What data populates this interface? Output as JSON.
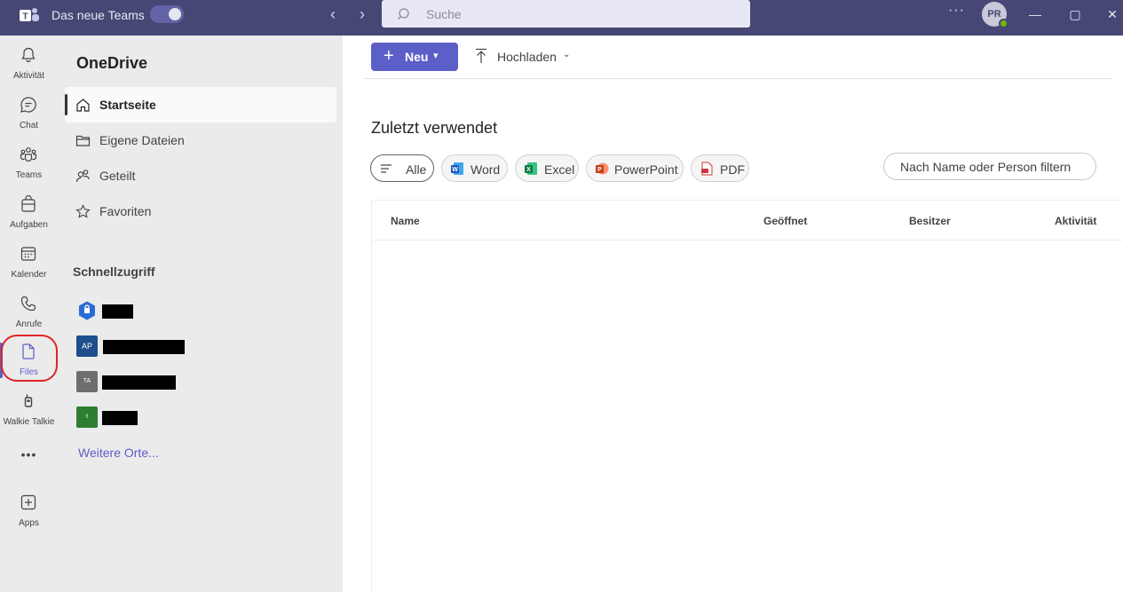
{
  "titlebar": {
    "app_title": "Das neue Teams",
    "search_placeholder": "Suche",
    "more": "···",
    "avatar_initials": "PR",
    "minimize": "—",
    "maximize": "▢",
    "close": "✕"
  },
  "rail": {
    "items": [
      {
        "label": "Aktivität",
        "icon": "bell-icon"
      },
      {
        "label": "Chat",
        "icon": "chat-icon"
      },
      {
        "label": "Teams",
        "icon": "teams-icon"
      },
      {
        "label": "Aufgaben",
        "icon": "tasks-icon"
      },
      {
        "label": "Kalender",
        "icon": "calendar-icon"
      },
      {
        "label": "Anrufe",
        "icon": "phone-icon"
      },
      {
        "label": "Files",
        "icon": "file-icon",
        "active": true
      },
      {
        "label": "Walkie Talkie",
        "icon": "walkie-talkie-icon"
      },
      {
        "label": "Apps",
        "icon": "add-app-icon"
      }
    ],
    "more": "•••"
  },
  "navpane": {
    "title": "OneDrive",
    "items": [
      {
        "label": "Startseite",
        "icon": "home-icon",
        "active": true
      },
      {
        "label": "Eigene Dateien",
        "icon": "folder-icon"
      },
      {
        "label": "Geteilt",
        "icon": "shared-people-icon"
      },
      {
        "label": "Favoriten",
        "icon": "star-icon"
      }
    ],
    "quick_access_title": "Schnellzugriff",
    "quick_access": [
      {
        "tile": "",
        "tile_color": "#2b6cd4",
        "redacted": true
      },
      {
        "tile": "AP",
        "tile_color": "#1e4e8c",
        "redacted": true
      },
      {
        "tile": "TA",
        "tile_color": "#6e6e6e",
        "redacted": true
      },
      {
        "tile": "t",
        "tile_color": "#2e7d32",
        "redacted": true
      }
    ],
    "more_places": "Weitere Orte..."
  },
  "main": {
    "new_button": "Neu",
    "upload_button": "Hochladen",
    "recent_title": "Zuletzt verwendet",
    "chips": [
      {
        "label": "Alle",
        "icon": "list-icon",
        "active": true
      },
      {
        "label": "Word",
        "icon": "word-icon"
      },
      {
        "label": "Excel",
        "icon": "excel-icon"
      },
      {
        "label": "PowerPoint",
        "icon": "powerpoint-icon"
      },
      {
        "label": "PDF",
        "icon": "pdf-icon"
      }
    ],
    "filter_placeholder": "Nach Name oder Person filtern",
    "columns": [
      "Name",
      "Geöffnet",
      "Besitzer",
      "Aktivität"
    ]
  },
  "colors": {
    "titlebar": "#464775",
    "accent": "#5b5fc7",
    "highlight_circle": "#e02424"
  }
}
